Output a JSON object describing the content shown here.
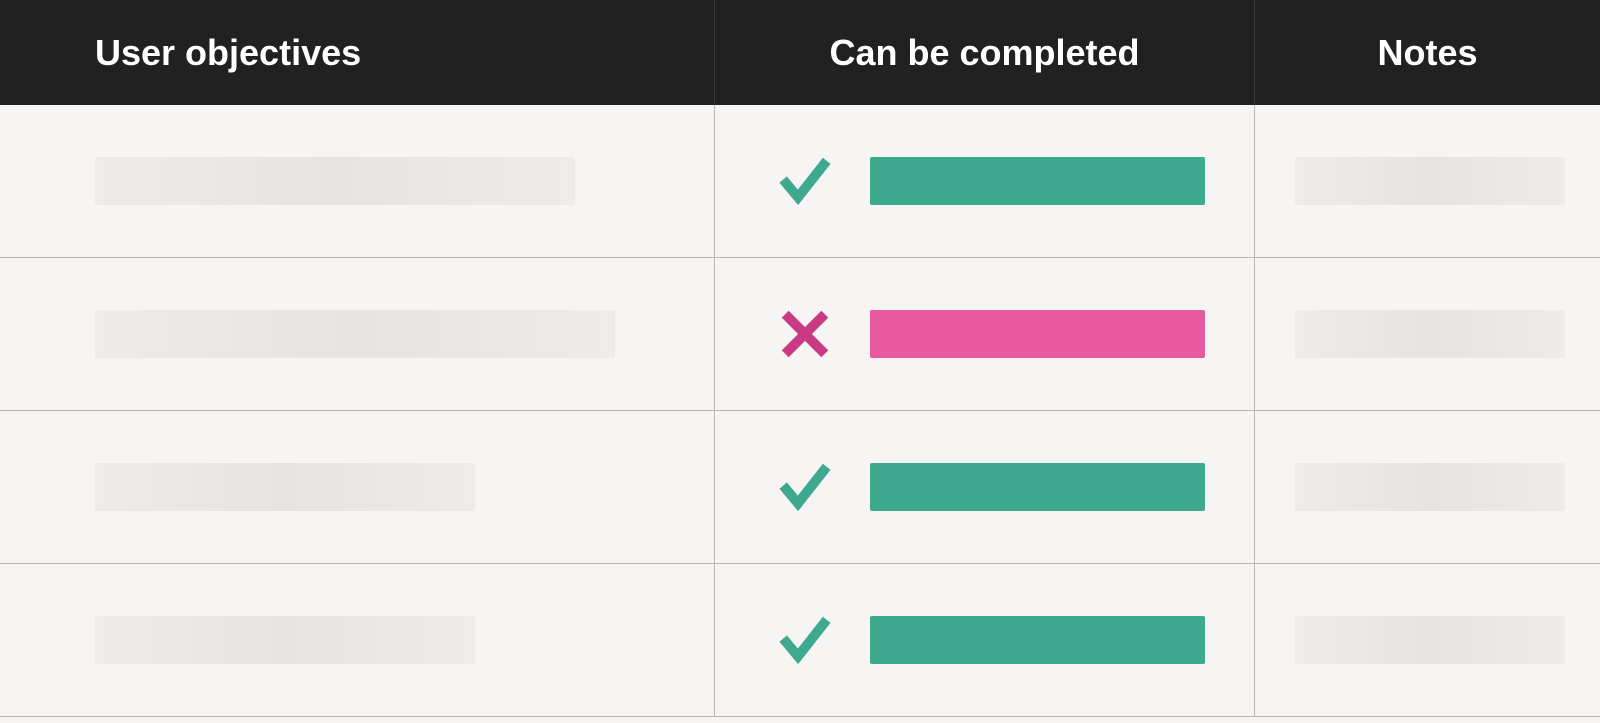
{
  "columns": {
    "objectives": "User objectives",
    "completed": "Can be completed",
    "notes": "Notes"
  },
  "colors": {
    "pass": "#3fa98f",
    "fail": "#e85a9f",
    "fail_icon": "#c93a84",
    "header_bg": "#212121",
    "placeholder": "#e9e6e5"
  },
  "rows": [
    {
      "status": "pass",
      "objective_width": 480
    },
    {
      "status": "fail",
      "objective_width": 520
    },
    {
      "status": "pass",
      "objective_width": 380
    },
    {
      "status": "pass",
      "objective_width": 380
    }
  ]
}
